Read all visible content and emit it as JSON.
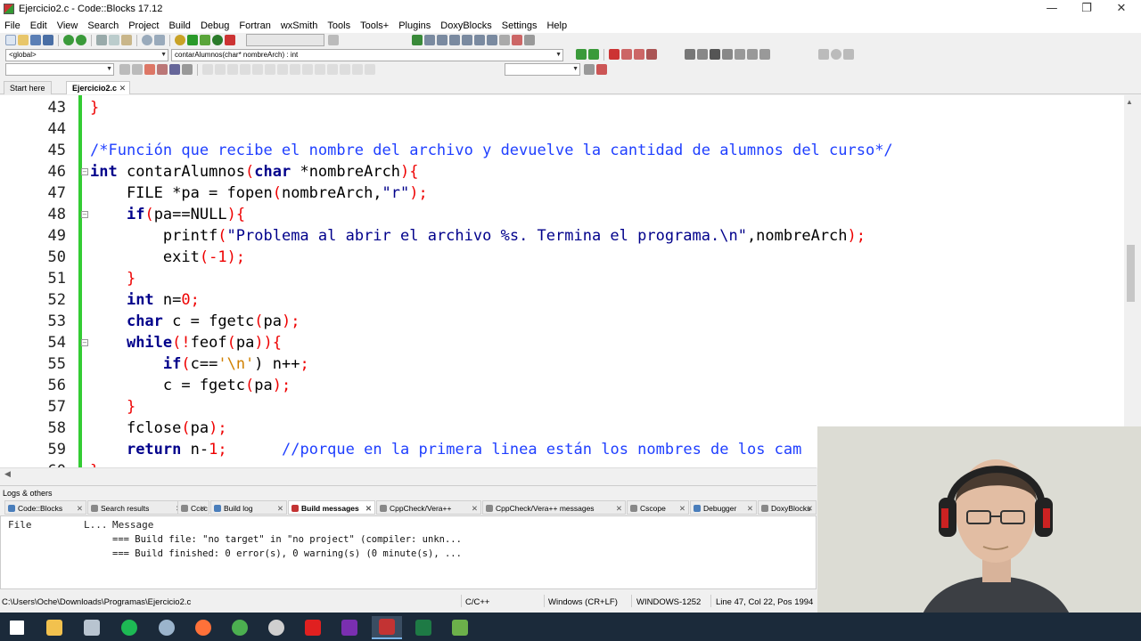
{
  "window": {
    "title": "Ejercicio2.c - Code::Blocks 17.12",
    "min": "—",
    "restore": "❐",
    "close": "✕"
  },
  "menu": [
    "File",
    "Edit",
    "View",
    "Search",
    "Project",
    "Build",
    "Debug",
    "Fortran",
    "wxSmith",
    "Tools",
    "Tools+",
    "Plugins",
    "DoxyBlocks",
    "Settings",
    "Help"
  ],
  "scope_combo": "<global>",
  "function_combo": "contarAlumnos(char* nombreArch) : int",
  "tabs": [
    {
      "label": "Start here"
    },
    {
      "label": "Ejercicio2.c",
      "close": "✕"
    }
  ],
  "editor": {
    "lines": [
      {
        "n": "43",
        "tokens": [
          {
            "t": "}",
            "c": "op"
          }
        ]
      },
      {
        "n": "44",
        "tokens": []
      },
      {
        "n": "45",
        "tokens": [
          {
            "t": "/*Función que recibe el nombre del archivo y devuelve la cantidad de alumnos del curso*/",
            "c": "cm"
          }
        ]
      },
      {
        "n": "46",
        "fold": "⊟",
        "tokens": [
          {
            "t": "int",
            "c": "kw"
          },
          {
            "t": " contarAlumnos",
            "c": ""
          },
          {
            "t": "(",
            "c": "op"
          },
          {
            "t": "char",
            "c": "kw"
          },
          {
            "t": " *nombreArch",
            "c": ""
          },
          {
            "t": "){",
            "c": "op"
          }
        ]
      },
      {
        "n": "47",
        "tokens": [
          {
            "t": "    FILE *pa = fopen",
            "c": ""
          },
          {
            "t": "(",
            "c": "op"
          },
          {
            "t": "nombreArch,",
            "c": ""
          },
          {
            "t": "\"r\"",
            "c": "st"
          },
          {
            "t": ");",
            "c": "op"
          }
        ]
      },
      {
        "n": "48",
        "fold": "⊟",
        "tokens": [
          {
            "t": "    ",
            "c": ""
          },
          {
            "t": "if",
            "c": "kw"
          },
          {
            "t": "(",
            "c": "op"
          },
          {
            "t": "pa==NULL",
            "c": ""
          },
          {
            "t": "){",
            "c": "op"
          }
        ]
      },
      {
        "n": "49",
        "tokens": [
          {
            "t": "        printf",
            "c": ""
          },
          {
            "t": "(",
            "c": "op"
          },
          {
            "t": "\"Problema al abrir el archivo %s. Termina el programa.\\n\"",
            "c": "st"
          },
          {
            "t": ",nombreArch",
            "c": ""
          },
          {
            "t": ");",
            "c": "op"
          }
        ]
      },
      {
        "n": "50",
        "tokens": [
          {
            "t": "        exit",
            "c": ""
          },
          {
            "t": "(-",
            "c": "op"
          },
          {
            "t": "1",
            "c": "nm"
          },
          {
            "t": ");",
            "c": "op"
          }
        ]
      },
      {
        "n": "51",
        "tokens": [
          {
            "t": "    ",
            "c": ""
          },
          {
            "t": "}",
            "c": "op"
          }
        ]
      },
      {
        "n": "52",
        "tokens": [
          {
            "t": "    ",
            "c": ""
          },
          {
            "t": "int",
            "c": "kw"
          },
          {
            "t": " n=",
            "c": ""
          },
          {
            "t": "0",
            "c": "nm"
          },
          {
            "t": ";",
            "c": "op"
          }
        ]
      },
      {
        "n": "53",
        "tokens": [
          {
            "t": "    ",
            "c": ""
          },
          {
            "t": "char",
            "c": "kw"
          },
          {
            "t": " c = fgetc",
            "c": ""
          },
          {
            "t": "(",
            "c": "op"
          },
          {
            "t": "pa",
            "c": ""
          },
          {
            "t": ");",
            "c": "op"
          }
        ]
      },
      {
        "n": "54",
        "fold": "⊟",
        "tokens": [
          {
            "t": "    ",
            "c": ""
          },
          {
            "t": "while",
            "c": "kw"
          },
          {
            "t": "(!",
            "c": "op"
          },
          {
            "t": "feof",
            "c": ""
          },
          {
            "t": "(",
            "c": "op"
          },
          {
            "t": "pa",
            "c": ""
          },
          {
            "t": ")){",
            "c": "op"
          }
        ]
      },
      {
        "n": "55",
        "tokens": [
          {
            "t": "        ",
            "c": ""
          },
          {
            "t": "if",
            "c": "kw"
          },
          {
            "t": "(",
            "c": "op"
          },
          {
            "t": "c==",
            "c": ""
          },
          {
            "t": "'\\n'",
            "c": "ch"
          },
          {
            "t": ") n++",
            "c": ""
          },
          {
            "t": ";",
            "c": "op"
          }
        ]
      },
      {
        "n": "56",
        "tokens": [
          {
            "t": "        c = fgetc",
            "c": ""
          },
          {
            "t": "(",
            "c": "op"
          },
          {
            "t": "pa",
            "c": ""
          },
          {
            "t": ");",
            "c": "op"
          }
        ]
      },
      {
        "n": "57",
        "tokens": [
          {
            "t": "    ",
            "c": ""
          },
          {
            "t": "}",
            "c": "op"
          }
        ]
      },
      {
        "n": "58",
        "tokens": [
          {
            "t": "    fclose",
            "c": ""
          },
          {
            "t": "(",
            "c": "op"
          },
          {
            "t": "pa",
            "c": ""
          },
          {
            "t": ");",
            "c": "op"
          }
        ]
      },
      {
        "n": "59",
        "tokens": [
          {
            "t": "    ",
            "c": ""
          },
          {
            "t": "return",
            "c": "kw"
          },
          {
            "t": " n-",
            "c": ""
          },
          {
            "t": "1",
            "c": "nm"
          },
          {
            "t": ";      ",
            "c": "op"
          },
          {
            "t": "//porque en la primera linea están los nombres de los cam",
            "c": "cm"
          }
        ]
      },
      {
        "n": "60",
        "tokens": [
          {
            "t": "}",
            "c": "op"
          }
        ]
      }
    ]
  },
  "logs": {
    "title": "Logs & others",
    "tabs": [
      {
        "label": "Code::Blocks",
        "color": "#4a7ebb"
      },
      {
        "label": "Search results",
        "color": "#888888"
      },
      {
        "label": "Cccc",
        "color": "#888888"
      },
      {
        "label": "Build log",
        "color": "#4a7ebb"
      },
      {
        "label": "Build messages",
        "color": "#c33333",
        "active": true
      },
      {
        "label": "CppCheck/Vera++",
        "color": "#888888"
      },
      {
        "label": "CppCheck/Vera++ messages",
        "color": "#888888"
      },
      {
        "label": "Cscope",
        "color": "#888888"
      },
      {
        "label": "Debugger",
        "color": "#4a7ebb"
      },
      {
        "label": "DoxyBlocks",
        "color": "#888888"
      }
    ],
    "close": "✕",
    "columns": {
      "file": "File",
      "line": "L...",
      "message": "Message"
    },
    "messages": [
      "=== Build file: \"no target\" in \"no project\" (compiler: unkn...",
      "=== Build finished: 0 error(s), 0 warning(s) (0 minute(s), ..."
    ]
  },
  "status": {
    "path": "C:\\Users\\Oche\\Downloads\\Programas\\Ejercicio2.c",
    "lang": "C/C++",
    "eol": "Windows (CR+LF)",
    "encoding": "WINDOWS-1252",
    "position": "Line 47, Col 22, Pos 1994"
  },
  "taskbar": [
    {
      "name": "windows-start-icon",
      "color": "#ffffff"
    },
    {
      "name": "file-explorer-icon",
      "color": "#f2c14e"
    },
    {
      "name": "laptop-icon",
      "color": "#b8c4d0"
    },
    {
      "name": "spotify-icon",
      "color": "#1db954"
    },
    {
      "name": "steam-icon",
      "color": "#9bb4cc"
    },
    {
      "name": "firefox-icon",
      "color": "#ff7139"
    },
    {
      "name": "chrome-icon",
      "color": "#4caf50"
    },
    {
      "name": "obs-icon",
      "color": "#cfcfcf"
    },
    {
      "name": "acrobat-icon",
      "color": "#e02020"
    },
    {
      "name": "onenote-icon",
      "color": "#7a2fb0"
    },
    {
      "name": "codeblocks-icon",
      "color": "#c33333",
      "active": true
    },
    {
      "name": "excel-icon",
      "color": "#1e7a45"
    },
    {
      "name": "notepad-icon",
      "color": "#6cb04a"
    }
  ]
}
